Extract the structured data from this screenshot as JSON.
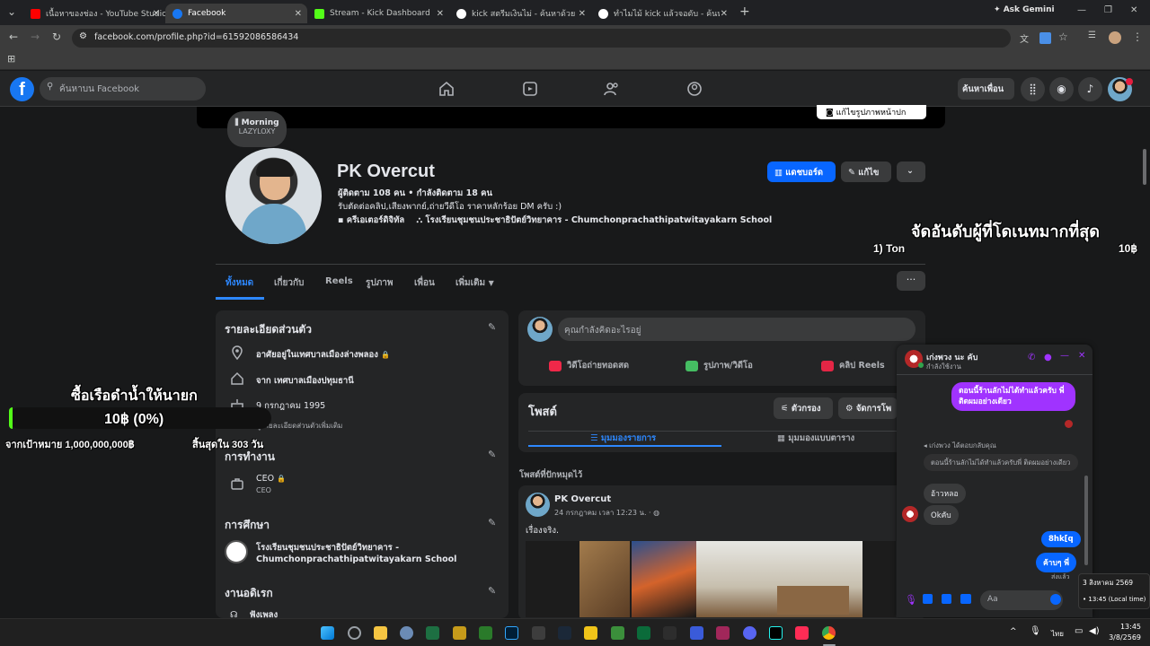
{
  "browser": {
    "tabs": [
      {
        "title": "เนื้อหาของช่อง - YouTube Studio",
        "color": "#ff0000"
      },
      {
        "title": "Facebook",
        "color": "#1877f2"
      },
      {
        "title": "Stream - Kick Dashboard",
        "color": "#53fc18"
      },
      {
        "title": "kick สตรีมเงินไม่ - ค้นหาด้วย Google",
        "color": "#ffffff"
      },
      {
        "title": "ทำไมไม้ kick แล้วจอดับ - ค้นหาด้วย Google",
        "color": "#ffffff"
      }
    ],
    "new_tab": "+",
    "ask_gemini": "Ask Gemini",
    "url": "facebook.com/profile.php?id=61592086586434"
  },
  "fb": {
    "search_placeholder": "ค้นหาบน Facebook",
    "find_friends": "ค้นหาเพื่อน"
  },
  "profile": {
    "cover_button": "แก้ไขรูปภาพหน้าปก",
    "music_title": "Morning",
    "music_artist": "LAZYLOXY",
    "name": "PK Overcut",
    "followers": "ผู้ติดตาม 108 คน • กำลังติดตาม 18 คน",
    "bio": "รับตัดต่อคลิป,เสียงพากย์,ถ่ายวีดีโอ ราคาหลักร้อย DM ครับ :)",
    "meta1": "ครีเอเตอร์ดิจิทัล",
    "meta2": "โรงเรียนชุมชนประชาธิปัตย์วิทยาคาร - Chumchonprachathipatwitayakarn School",
    "dashboard_btn": "แดชบอร์ด",
    "edit_btn": "แก้ไข",
    "tabs": [
      "ทั้งหมด",
      "เกี่ยวกับ",
      "Reels",
      "รูปภาพ",
      "เพื่อน",
      "เพิ่มเติม"
    ]
  },
  "intro": {
    "title": "รายละเอียดส่วนตัว",
    "lives": "อาศัยอยู่ในเทศบาลเมืองล่างพลอง",
    "from": "จาก เทศบาลเมืองปทุมธานี",
    "birthday": "9 กรกฎาคม 1995",
    "more_details": "ดูรายละเอียดส่วนตัวเพิ่มเติม",
    "work_title": "การทำงาน",
    "work_role": "CEO",
    "work_sub": "CEO",
    "edu_title": "การศึกษา",
    "edu_school": "โรงเรียนชุมชนประชาธิปัตย์วิทยาคาร - Chumchonprachathipatwitayakarn School",
    "hobbies_title": "งานอดิเรก",
    "hobby1": "ฟังเพลง"
  },
  "composer": {
    "placeholder": "คุณกำลังคิดอะไรอยู่",
    "live": "วิดีโอถ่ายทอดสด",
    "photo": "รูปภาพ/วิดีโอ",
    "reel": "คลิป Reels"
  },
  "posts": {
    "title": "โพสต์",
    "filter": "ตัวกรอง",
    "manage": "จัดการโพ",
    "list_view": "มุมมองรายการ",
    "grid_view": "มุมมองแบบตาราง",
    "pinned": "โพสต์ที่ปักหมุดไว้",
    "author": "PK Overcut",
    "date": "24 กรกฎาคม เวลา 12:23 น. ·",
    "text": "เรื่องจริง."
  },
  "overlay": {
    "rank_title": "จัดอันดับผู้ที่โดเนทมากที่สุด",
    "rank1_name": "1) Ton",
    "rank1_amount": "10฿",
    "goal_title": "ซื้อเรือดำน้ำให้นายก",
    "goal_progress": "10฿ (0%)",
    "goal_target": "จากเป้าหมาย 1,000,000,000฿",
    "goal_ends": "สิ้นสุดใน 303 วัน"
  },
  "messenger": {
    "contact": "เก่งพวง นะ คับ",
    "status": "กำลังใช้งาน",
    "msg1": "ตอนนี้ร้านลักไม่ได้ทำแล้วครับ พี่ ติดผมอย่างเดียว",
    "reply_label": "เก่งพวง ได้ตอบกลับคุณ",
    "quoted": "ตอนนี้ร้านลักไม่ได้ทำแล้วครับพี่ ติดผมอย่างเดียว",
    "msg2": "อ้าวหลอ",
    "msg3": "Okคับ",
    "msg4": "8hk[q",
    "msg5": "ค้าบๆ พี่",
    "seen": "ส่งแล้ว",
    "input_placeholder": "Aa"
  },
  "taskbar": {
    "lang": "ไทย",
    "time": "13:45",
    "date": "3/8/2569",
    "tooltip_date": "3 สิงหาคม 2569",
    "tooltip_time": "13:45 (Local time)"
  }
}
